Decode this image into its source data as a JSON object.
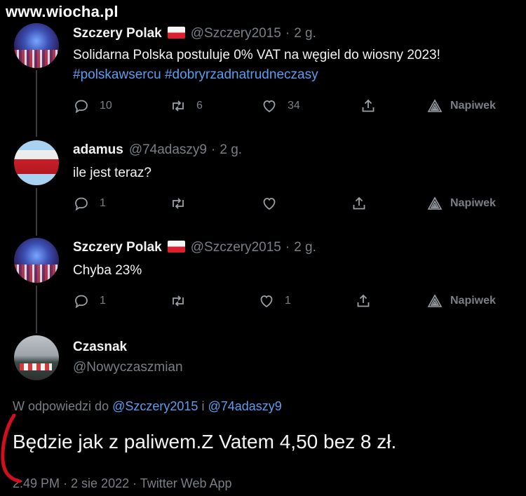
{
  "watermark": "www.wiocha.pl",
  "tweets": [
    {
      "name": "Szczery Polak",
      "has_flag": true,
      "handle": "@Szczery2015",
      "time": "2 g.",
      "text_line1": "Solidarna Polska postuluje 0% VAT na węgiel do wiosny 2023!",
      "hashtags": "#polskawsercu #dobryrzadnatrudneczasy",
      "replies": "10",
      "retweets": "6",
      "likes": "34",
      "tip_label": "Napiwek",
      "avatar": "crowd-photo"
    },
    {
      "name": "adamus",
      "handle": "@74adaszy9",
      "time": "2 g.",
      "text_line1": "ile jest teraz?",
      "replies": "1",
      "retweets": "",
      "likes": "",
      "tip_label": "Napiwek",
      "avatar": "polish-flag-photo"
    },
    {
      "name": "Szczery Polak",
      "has_flag": true,
      "handle": "@Szczery2015",
      "time": "2 g.",
      "text_line1": "Chyba 23%",
      "replies": "1",
      "retweets": "",
      "likes": "1",
      "tip_label": "Napiwek",
      "avatar": "crowd-photo"
    }
  ],
  "main_tweet": {
    "name": "Czasnak",
    "handle": "@Nowyczaszmian",
    "reply_prefix": "W odpowiedzi do",
    "mention1": "@Szczery2015",
    "reply_joiner": "i",
    "mention2": "@74adaszy9",
    "text": "Będzie jak z paliwem.Z Vatem 4,50 bez 8 zł.",
    "meta": "2:49 PM · 2 sie 2022 · Twitter Web App"
  },
  "colors": {
    "background": "#000000",
    "link": "#5b9ef0",
    "muted": "#7a7f85",
    "annotation": "#d0101a"
  },
  "icons": [
    "reply-icon",
    "retweet-icon",
    "like-icon",
    "share-icon",
    "tip-icon"
  ]
}
